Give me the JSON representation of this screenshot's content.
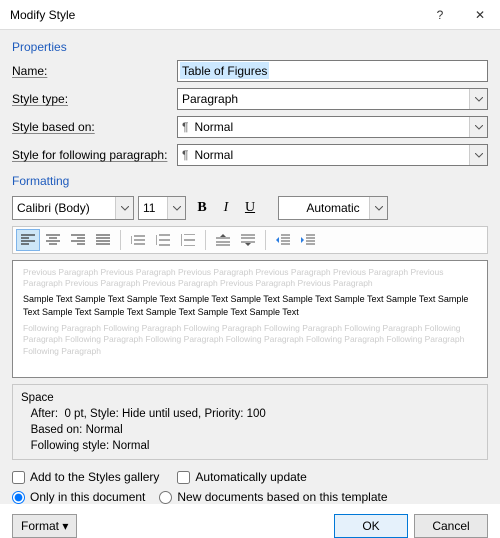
{
  "titlebar": {
    "title": "Modify Style",
    "help": "?",
    "close": "✕"
  },
  "sections": {
    "properties": "Properties",
    "formatting": "Formatting"
  },
  "labels": {
    "name": "Name:",
    "style_type": "Style type:",
    "style_based_on": "Style based on:",
    "style_following": "Style for following paragraph:"
  },
  "values": {
    "name": "Table of Figures",
    "style_type": "Paragraph",
    "based_on": "Normal",
    "following": "Normal",
    "font": "Calibri (Body)",
    "size": "11",
    "color": "Automatic"
  },
  "preview": {
    "ghost_before": "Previous Paragraph Previous Paragraph Previous Paragraph Previous Paragraph Previous Paragraph Previous Paragraph Previous Paragraph Previous Paragraph Previous Paragraph Previous Paragraph",
    "sample": "Sample Text Sample Text Sample Text Sample Text Sample Text Sample Text Sample Text Sample Text Sample Text Sample Text Sample Text Sample Text Sample Text Sample Text",
    "ghost_after": "Following Paragraph Following Paragraph Following Paragraph Following Paragraph Following Paragraph Following Paragraph Following Paragraph Following Paragraph Following Paragraph Following Paragraph Following Paragraph Following Paragraph"
  },
  "description": {
    "l1": "Space",
    "l2": "   After:  0 pt, Style: Hide until used, Priority: 100",
    "l3": "   Based on: Normal",
    "l4": "   Following style: Normal"
  },
  "checks": {
    "add_gallery": "Add to the Styles gallery",
    "auto_update": "Automatically update"
  },
  "radios": {
    "only_doc": "Only in this document",
    "new_docs": "New documents based on this template"
  },
  "buttons": {
    "format": "Format ▾",
    "ok": "OK",
    "cancel": "Cancel"
  }
}
